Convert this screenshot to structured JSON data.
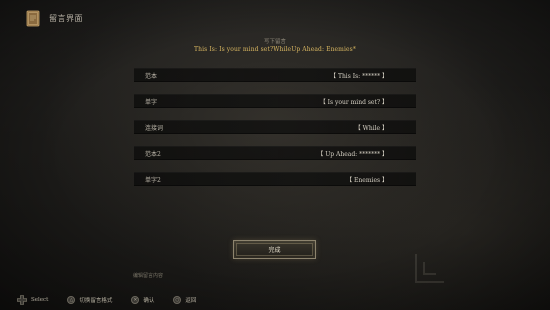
{
  "header": {
    "title": "留言界面",
    "icon": "book-icon"
  },
  "composer": {
    "label": "写下留言",
    "preview": "This Is: Is your mind set?WhileUp Ahead: Enemies*"
  },
  "rows": [
    {
      "label": "范本",
      "value": "【 This Is: ****** 】"
    },
    {
      "label": "单字",
      "value": "【 Is your mind set? 】"
    },
    {
      "label": "连接词",
      "value": "【 While 】"
    },
    {
      "label": "范本2",
      "value": "【 Up Ahead: ******* 】"
    },
    {
      "label": "单字2",
      "value": "【 Enemies 】"
    }
  ],
  "confirm_label": "完成",
  "hint": "编辑留言内容",
  "footer": {
    "select_label": "Select",
    "switch_label": "切换留言格式",
    "confirm_label": "确认",
    "back_label": "返回",
    "glyphs": {
      "switch": "△",
      "confirm": "✕",
      "back": "○"
    }
  },
  "colors": {
    "accent": "#d8b661",
    "text": "#c9c4b8",
    "background": "#1c1b19"
  }
}
